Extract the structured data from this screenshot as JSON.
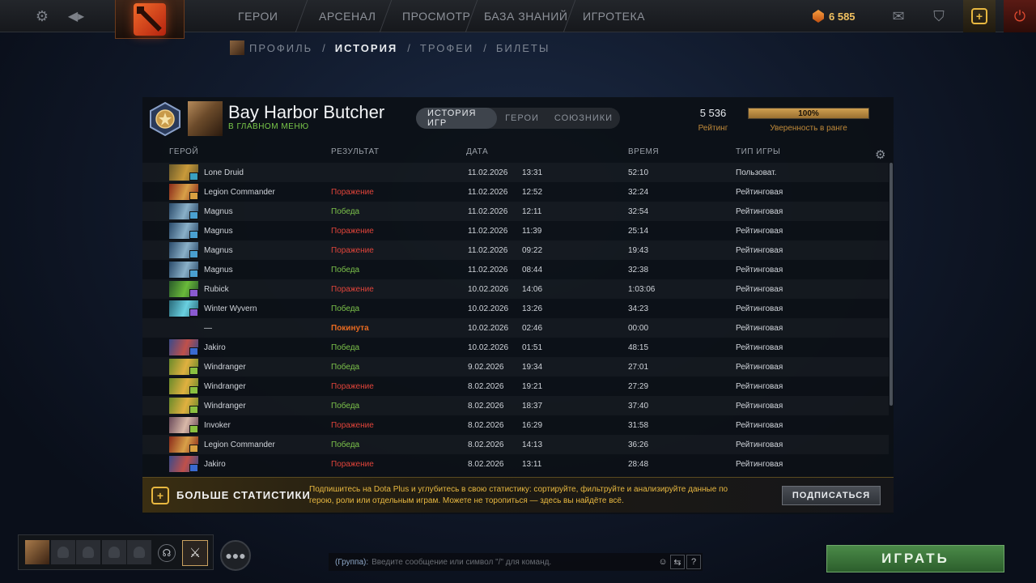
{
  "topbar": {
    "nav": [
      "ГЕРОИ",
      "АРСЕНАЛ",
      "ПРОСМОТР",
      "БАЗА ЗНАНИЙ",
      "ИГРОТЕКА"
    ],
    "shards": "6 585"
  },
  "subnav": {
    "items": [
      "ПРОФИЛЬ",
      "ИСТОРИЯ",
      "ТРОФЕИ",
      "БИЛЕТЫ"
    ],
    "separator": "/"
  },
  "player": {
    "name": "Bay Harbor Butcher",
    "status": "В ГЛАВНОМ МЕНЮ"
  },
  "tabs": [
    "ИСТОРИЯ ИГР",
    "ГЕРОИ",
    "СОЮЗНИКИ"
  ],
  "rating": {
    "value": "5 536",
    "label": "Рейтинг",
    "confidence": "100%",
    "confidence_fraction": 1.0,
    "confidence_label": "Уверенность в ранге"
  },
  "columns": {
    "hero": "ГЕРОЙ",
    "result": "РЕЗУЛЬТАТ",
    "date": "ДАТА",
    "time": "ВРЕМЯ",
    "gametype": "ТИП ИГРЫ"
  },
  "matches": [
    {
      "hero": "Lone Druid",
      "result": "",
      "kind": "none",
      "date": "11.02.2026",
      "clock": "13:31",
      "duration": "52:10",
      "type": "Пользоват.",
      "colors": [
        "#6a5a2a",
        "#c89a3a"
      ],
      "badge": "#3aa0c0"
    },
    {
      "hero": "Legion Commander",
      "result": "Поражение",
      "kind": "loss",
      "date": "11.02.2026",
      "clock": "12:52",
      "duration": "32:24",
      "type": "Рейтинговая",
      "colors": [
        "#8a2a1a",
        "#d8a048"
      ],
      "badge": "#d8a040"
    },
    {
      "hero": "Magnus",
      "result": "Победа",
      "kind": "win",
      "date": "11.02.2026",
      "clock": "12:11",
      "duration": "32:54",
      "type": "Рейтинговая",
      "colors": [
        "#2a4a6a",
        "#8ab0c8"
      ],
      "badge": "#4aa0d0"
    },
    {
      "hero": "Magnus",
      "result": "Поражение",
      "kind": "loss",
      "date": "11.02.2026",
      "clock": "11:39",
      "duration": "25:14",
      "type": "Рейтинговая",
      "colors": [
        "#2a4a6a",
        "#8ab0c8"
      ],
      "badge": "#4aa0d0"
    },
    {
      "hero": "Magnus",
      "result": "Поражение",
      "kind": "loss",
      "date": "11.02.2026",
      "clock": "09:22",
      "duration": "19:43",
      "type": "Рейтинговая",
      "colors": [
        "#2a4a6a",
        "#8ab0c8"
      ],
      "badge": "#4aa0d0"
    },
    {
      "hero": "Magnus",
      "result": "Победа",
      "kind": "win",
      "date": "11.02.2026",
      "clock": "08:44",
      "duration": "32:38",
      "type": "Рейтинговая",
      "colors": [
        "#2a4a6a",
        "#8ab0c8"
      ],
      "badge": "#4aa0d0"
    },
    {
      "hero": "Rubick",
      "result": "Поражение",
      "kind": "loss",
      "date": "10.02.2026",
      "clock": "14:06",
      "duration": "1:03:06",
      "type": "Рейтинговая",
      "colors": [
        "#2a5a2a",
        "#6aba3a"
      ],
      "badge": "#8a5ad0"
    },
    {
      "hero": "Winter Wyvern",
      "result": "Победа",
      "kind": "win",
      "date": "10.02.2026",
      "clock": "13:26",
      "duration": "34:23",
      "type": "Рейтинговая",
      "colors": [
        "#2a6a7a",
        "#6ad0e0"
      ],
      "badge": "#8a5ad0"
    },
    {
      "hero": "—",
      "result": "Покинута",
      "kind": "abandon",
      "date": "10.02.2026",
      "clock": "02:46",
      "duration": "00:00",
      "type": "Рейтинговая",
      "colors": null,
      "badge": null
    },
    {
      "hero": "Jakiro",
      "result": "Победа",
      "kind": "win",
      "date": "10.02.2026",
      "clock": "01:51",
      "duration": "48:15",
      "type": "Рейтинговая",
      "colors": [
        "#3a4a8a",
        "#c0504a"
      ],
      "badge": "#3a6ad0"
    },
    {
      "hero": "Windranger",
      "result": "Победа",
      "kind": "win",
      "date": "9.02.2026",
      "clock": "19:34",
      "duration": "27:01",
      "type": "Рейтинговая",
      "colors": [
        "#6a8a2a",
        "#e0b040"
      ],
      "badge": "#8ac040"
    },
    {
      "hero": "Windranger",
      "result": "Поражение",
      "kind": "loss",
      "date": "8.02.2026",
      "clock": "19:21",
      "duration": "27:29",
      "type": "Рейтинговая",
      "colors": [
        "#6a8a2a",
        "#e0b040"
      ],
      "badge": "#8ac040"
    },
    {
      "hero": "Windranger",
      "result": "Победа",
      "kind": "win",
      "date": "8.02.2026",
      "clock": "18:37",
      "duration": "37:40",
      "type": "Рейтинговая",
      "colors": [
        "#6a8a2a",
        "#e0b040"
      ],
      "badge": "#8ac040"
    },
    {
      "hero": "Invoker",
      "result": "Поражение",
      "kind": "loss",
      "date": "8.02.2026",
      "clock": "16:29",
      "duration": "31:58",
      "type": "Рейтинговая",
      "colors": [
        "#6a4a5a",
        "#d8b8a8"
      ],
      "badge": "#8ac040"
    },
    {
      "hero": "Legion Commander",
      "result": "Победа",
      "kind": "win",
      "date": "8.02.2026",
      "clock": "14:13",
      "duration": "36:26",
      "type": "Рейтинговая",
      "colors": [
        "#8a2a1a",
        "#d8a048"
      ],
      "badge": "#d8a040"
    },
    {
      "hero": "Jakiro",
      "result": "Поражение",
      "kind": "loss",
      "date": "8.02.2026",
      "clock": "13:11",
      "duration": "28:48",
      "type": "Рейтинговая",
      "colors": [
        "#3a4a8a",
        "#c0504a"
      ],
      "badge": "#3a6ad0"
    }
  ],
  "dota_plus": {
    "title": "БОЛЬШЕ СТАТИСТИКИ",
    "text": "Подпишитесь на Dota Plus и углубитесь в свою статистику: сортируйте, фильтруйте и анализируйте данные по герою, роли или отдельным играм. Можете не торопиться — здесь вы найдёте всё.",
    "button": "ПОДПИСАТЬСЯ"
  },
  "chat": {
    "channel": "(Группа):",
    "placeholder": "Введите сообщение или символ \"/\" для команд.",
    "help": "?"
  },
  "play_button": "ИГРАТЬ",
  "colors": {
    "win": "#7cc24a",
    "loss": "#e0443a",
    "abandon": "#e86a20",
    "accent_gold": "#e8b840"
  }
}
